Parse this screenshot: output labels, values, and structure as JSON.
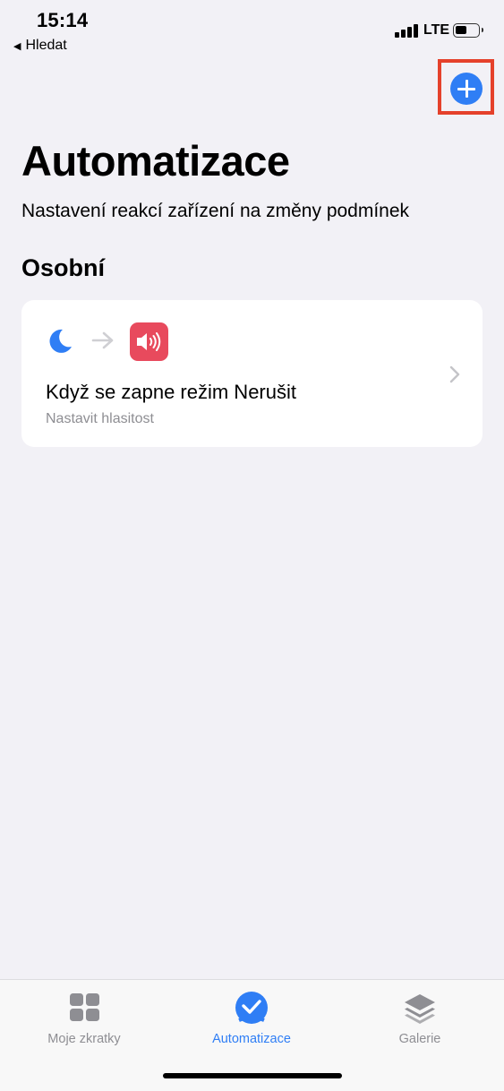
{
  "status_bar": {
    "time": "15:14",
    "back_label": "Hledat",
    "network": "LTE"
  },
  "header": {
    "add_icon": "plus-circle-icon",
    "title": "Automatizace",
    "subtitle": "Nastavení reakcí zařízení na změny podmínek"
  },
  "section": {
    "title": "Osobní"
  },
  "automation": {
    "trigger_icon": "moon-icon",
    "action_icon": "speaker-volume-icon",
    "title": "Když se zapne režim Nerušit",
    "subtitle": "Nastavit hlasitost"
  },
  "tabs": [
    {
      "label": "Moje zkratky",
      "icon": "grid-icon",
      "active": false
    },
    {
      "label": "Automatizace",
      "icon": "checkmark-circle-icon",
      "active": true
    },
    {
      "label": "Galerie",
      "icon": "layers-icon",
      "active": false
    }
  ],
  "colors": {
    "accent": "#2f7ef5",
    "highlight": "#e5412b",
    "action_tile": "#e84a5d",
    "background": "#f2f1f6"
  }
}
